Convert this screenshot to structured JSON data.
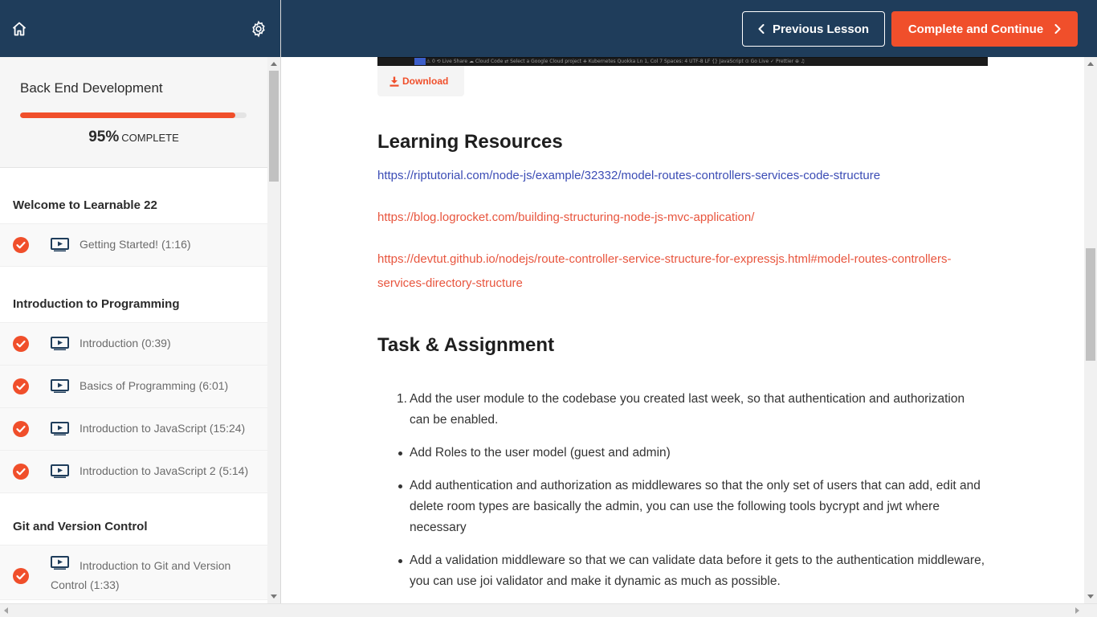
{
  "nav": {
    "home_icon": "home-icon",
    "settings_icon": "gear-icon",
    "prev_label": "Previous Lesson",
    "next_label": "Complete and Continue"
  },
  "course": {
    "title": "Back End Development",
    "progress_percent": 95,
    "progress_pct_text": "95%",
    "progress_label": "COMPLETE"
  },
  "sections": [
    {
      "title": "Welcome to Learnable 22",
      "lectures": [
        {
          "label": "Getting Started! (1:16)",
          "completed": true
        }
      ]
    },
    {
      "title": "Introduction to Programming",
      "lectures": [
        {
          "label": "Introduction (0:39)",
          "completed": true
        },
        {
          "label": "Basics of Programming (6:01)",
          "completed": true
        },
        {
          "label": "Introduction to JavaScript (15:24)",
          "completed": true
        },
        {
          "label": "Introduction to JavaScript 2 (5:14)",
          "completed": true
        }
      ]
    },
    {
      "title": "Git and Version Control",
      "lectures": [
        {
          "label": "Introduction to Git and Version Control (1:33)",
          "completed": true
        }
      ]
    }
  ],
  "content": {
    "statusbar_text": "⊗ 1 ⚠ 0   ⟲ Live Share    ☁ Cloud Code    ⇄ Select a Google Cloud project    ⎈ Kubernetes    Quokka                                                                                                                         Ln 1, Col 7   Spaces: 4   UTF-8   LF   {} JavaScript   ⊙ Go Live   ✓ Prettier   ⊕   ♫",
    "download_label": "Download",
    "resources_heading": "Learning Resources",
    "links": [
      "https://riptutorial.com/node-js/example/32332/model-routes-controllers-services-code-structure",
      "https://blog.logrocket.com/building-structuring-node-js-mvc-application/",
      "https://devtut.github.io/nodejs/route-controller-service-structure-for-expressjs.html#model-routes-controllers-services-directory-structure"
    ],
    "task_heading": "Task & Assignment",
    "tasks": [
      {
        "marker": "1.",
        "text": "Add the user module to the codebase you created last week, so that authentication and authorization can be enabled."
      },
      {
        "marker": "•",
        "text": "Add Roles to the user model  (guest and admin)"
      },
      {
        "marker": "•",
        "text": "Add authentication and authorization as middlewares so that the only set of users that can add, edit and delete room types are basically the admin, you can use the following tools bycrypt and jwt where necessary"
      },
      {
        "marker": "•",
        "text": "Add a validation middleware so that we can validate data before it gets to the authentication middleware, you can use joi validator and make it dynamic as much as possible."
      }
    ]
  },
  "colors": {
    "navy": "#1f3d5b",
    "accent": "#f04f2b",
    "link_blue": "#3b4cb5",
    "link_red": "#e8553e"
  }
}
